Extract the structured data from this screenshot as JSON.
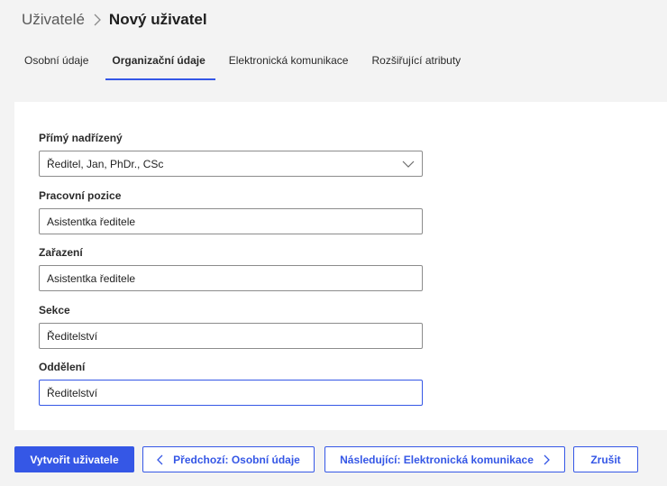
{
  "breadcrumb": {
    "parent": "Uživatelé",
    "current": "Nový uživatel"
  },
  "tabs": [
    {
      "label": "Osobní údaje",
      "active": false
    },
    {
      "label": "Organizační údaje",
      "active": true
    },
    {
      "label": "Elektronická komunikace",
      "active": false
    },
    {
      "label": "Rozšiřující atributy",
      "active": false
    }
  ],
  "form": {
    "supervisor": {
      "label": "Přímý nadřízený",
      "value": "Ředitel, Jan, PhDr., CSc"
    },
    "position": {
      "label": "Pracovní pozice",
      "value": "Asistentka ředitele"
    },
    "classification": {
      "label": "Zařazení",
      "value": "Asistentka ředitele"
    },
    "section": {
      "label": "Sekce",
      "value": "Ředitelství"
    },
    "department": {
      "label": "Oddělení",
      "value": "Ředitelství"
    }
  },
  "actions": {
    "create": "Vytvořit uživatele",
    "previous": "Předchozí: Osobní údaje",
    "next": "Následující: Elektronická komunikace",
    "cancel": "Zrušit"
  },
  "colors": {
    "accent": "#3557e6",
    "background": "#f3f3f3",
    "panel": "#ffffff"
  }
}
